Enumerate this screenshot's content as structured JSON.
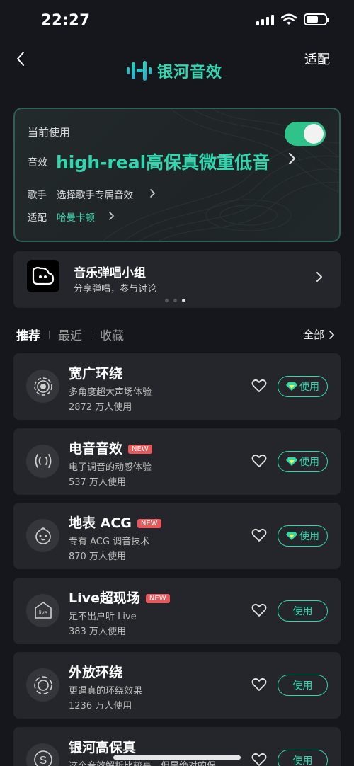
{
  "status_bar": {
    "time": "22:27"
  },
  "nav": {
    "logo_text": "银河音效",
    "adapt_label": "适配"
  },
  "current": {
    "label": "当前使用",
    "toggle_on": true,
    "effect_label": "音效",
    "effect_value": "high-real高保真微重低音",
    "singer_label": "歌手",
    "singer_value": "选择歌手专属音效",
    "fit_label": "适配",
    "fit_value": "哈曼卡顿"
  },
  "banner": {
    "title": "音乐弹唱小组",
    "subtitle": "分享弹唱，参与讨论",
    "page_index": 3,
    "page_count": 3
  },
  "tabs": {
    "items": [
      "推荐",
      "最近",
      "收藏"
    ],
    "active": "推荐",
    "all_label": "全部"
  },
  "effects": [
    {
      "title": "宽广环绕",
      "new_badge": "",
      "desc": "多角度超大声场体验",
      "users": "2872 万人使用",
      "icon": "surround-icon",
      "use_label": "使用",
      "vip": true
    },
    {
      "title": "电音音效",
      "new_badge": "NEW",
      "desc": "电子调音的动感体验",
      "users": "537 万人使用",
      "icon": "sound-waves-icon",
      "use_label": "使用",
      "vip": true
    },
    {
      "title": "地表 ACG",
      "new_badge": "NEW",
      "desc": "专有 ACG 调音技术",
      "users": "870 万人使用",
      "icon": "anime-face-icon",
      "use_label": "使用",
      "vip": true
    },
    {
      "title": "Live超现场",
      "new_badge": "NEW",
      "desc": "足不出户听 Live",
      "users": "383 万人使用",
      "icon": "live-house-icon",
      "use_label": "使用",
      "vip": false
    },
    {
      "title": "外放环绕",
      "new_badge": "",
      "desc": "更逼真的环绕效果",
      "users": "1236 万人使用",
      "icon": "speaker-surround-icon",
      "use_label": "使用",
      "vip": false
    },
    {
      "title": "银河高保真",
      "new_badge": "",
      "desc": "这个音效解析比较高，但是绝对的保…",
      "users": "",
      "icon": "hifi-s-icon",
      "use_label": "使用",
      "vip": false
    }
  ],
  "colors": {
    "accent": "#32d6ae",
    "toggle": "#2fc28a",
    "background": "#16171d",
    "card": "#25262c",
    "new_badge": "#e8585a"
  }
}
